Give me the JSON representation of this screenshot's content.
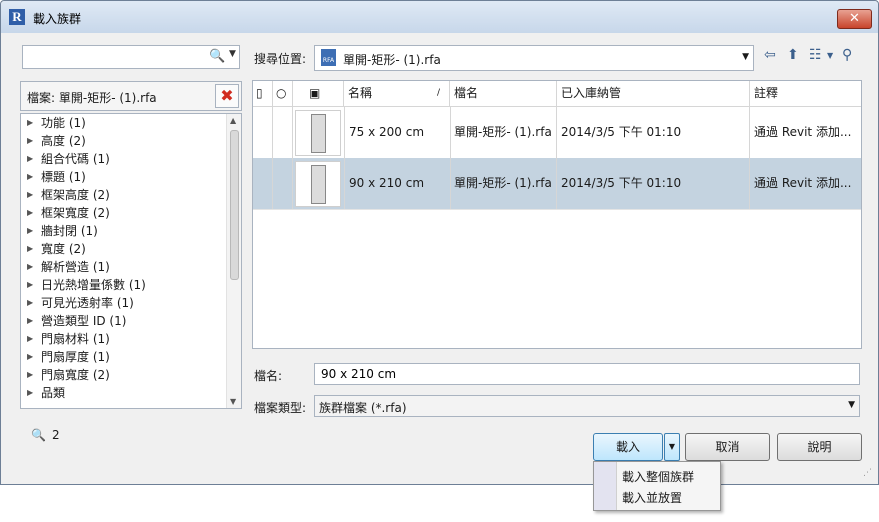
{
  "window": {
    "title": "載入族群"
  },
  "search": {
    "value": "",
    "placeholder": ""
  },
  "file_filter": {
    "label": "檔案: 單開-矩形- (1).rfa"
  },
  "tree_items": [
    "功能 (1)",
    "高度 (2)",
    "組合代碼 (1)",
    "標題 (1)",
    "框架高度 (2)",
    "框架寬度 (2)",
    "牆封閉 (1)",
    "寬度 (2)",
    "解析營造 (1)",
    "日光熱增量係數 (1)",
    "可見光透射率 (1)",
    "營造類型 ID (1)",
    "門扇材料 (1)",
    "門扇厚度 (1)",
    "門扇寬度 (2)",
    "品類"
  ],
  "result_count": "2",
  "location": {
    "label": "搜尋位置:",
    "value": "單開-矩形- (1).rfa",
    "file_icon_text": "RFA"
  },
  "grid": {
    "headers": {
      "name": "名稱",
      "file": "檔名",
      "checkin": "已入庫納管",
      "comment": "註釋"
    },
    "rows": [
      {
        "name": "75 x 200 cm",
        "file": "單開-矩形- (1).rfa",
        "checkin": "2014/3/5 下午 01:10",
        "comment": "通過 Revit 添加...",
        "selected": false
      },
      {
        "name": "90 x 210 cm",
        "file": "單開-矩形- (1).rfa",
        "checkin": "2014/3/5 下午 01:10",
        "comment": "通過 Revit 添加...",
        "selected": true
      }
    ]
  },
  "filename": {
    "label": "檔名:",
    "value": "90 x 210 cm"
  },
  "filetype": {
    "label": "檔案類型:",
    "value": "族群檔案 (*.rfa)"
  },
  "buttons": {
    "load": "載入",
    "cancel": "取消",
    "help": "說明"
  },
  "load_menu": [
    "載入整個族群",
    "載入並放置"
  ]
}
